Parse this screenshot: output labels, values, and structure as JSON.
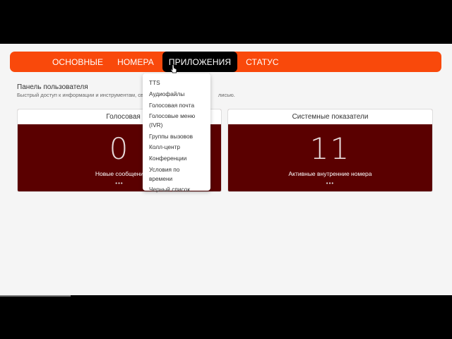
{
  "nav": {
    "items": [
      {
        "label": "ОСНОВНЫЕ"
      },
      {
        "label": "НОМЕРА"
      },
      {
        "label": "ПРИЛОЖЕНИЯ"
      },
      {
        "label": "СТАТУС"
      }
    ]
  },
  "panel": {
    "title": "Панель пользователя",
    "subtitle_start": "Быстрый доступ к информации и инструментам, свя",
    "subtitle_end": "лисью."
  },
  "cards": [
    {
      "title": "Голосовая почта",
      "value": "0",
      "caption": "Новые сообщени",
      "dots": "•••"
    },
    {
      "title": "Системные показатели",
      "value": "11",
      "caption": "Активные внутренние номера",
      "dots": "•••"
    }
  ],
  "dropdown": {
    "items": [
      "TTS",
      "Аудиофайлы",
      "Голосовая почта",
      "Голосовые меню",
      "(IVR)",
      "Группы вызовов",
      "Колл-центр",
      "Конференции",
      "Условия по времени",
      "Черный список"
    ]
  },
  "colors": {
    "accent": "#f9490b",
    "card_bg": "#5a0000",
    "active_tab": "#000000"
  }
}
